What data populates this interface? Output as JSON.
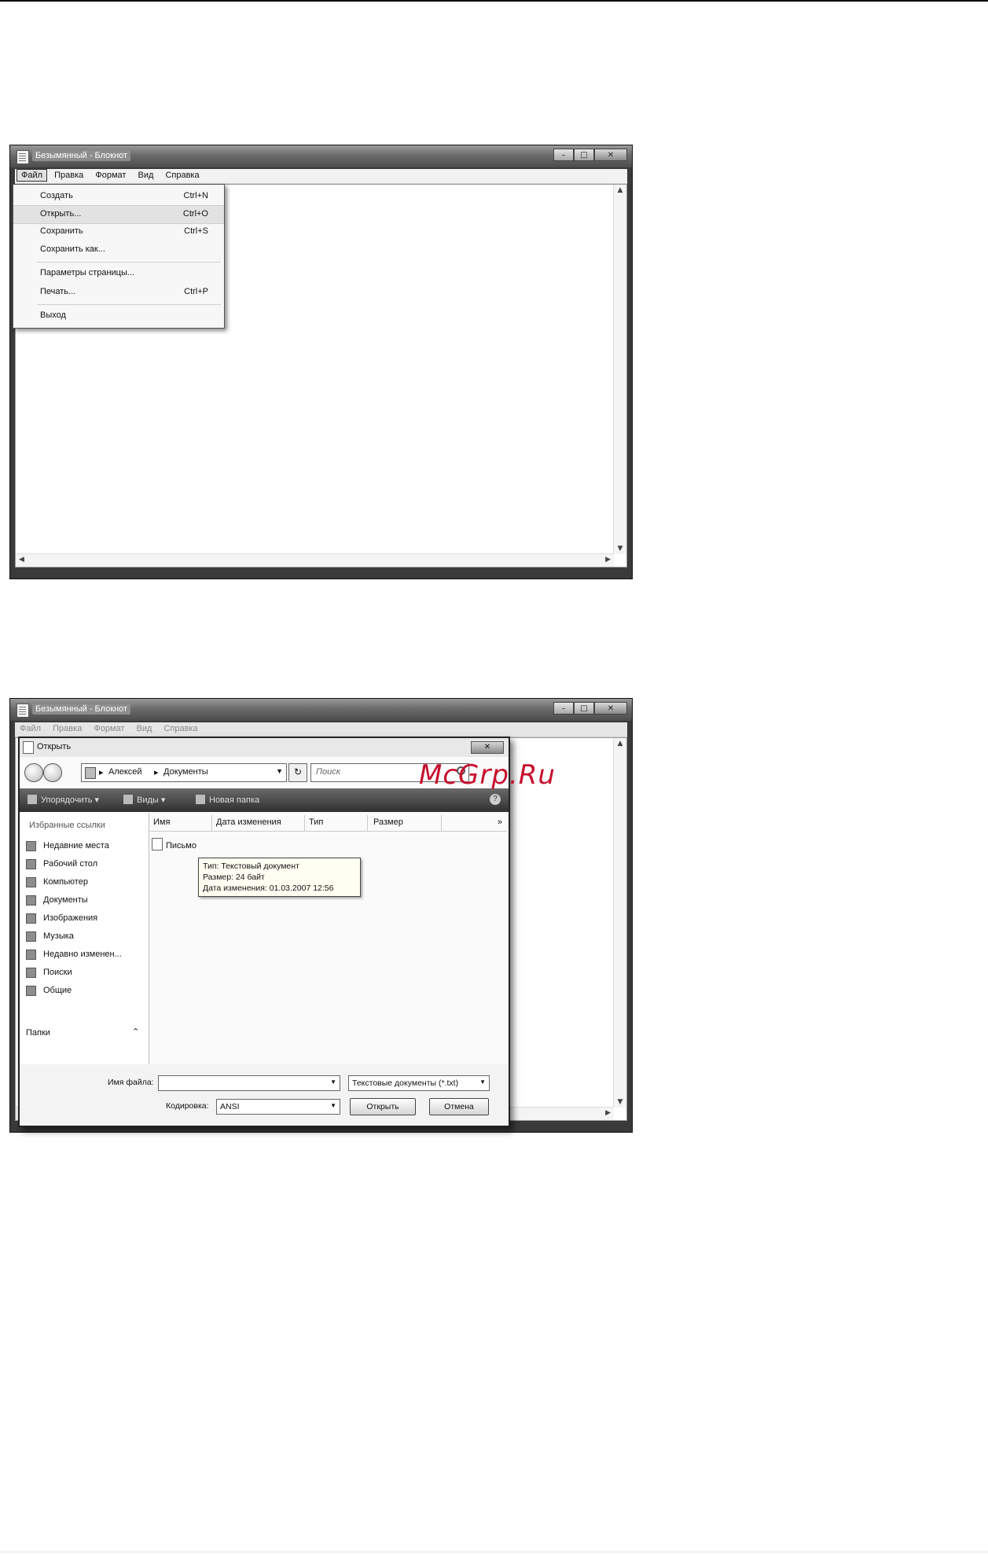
{
  "notepad": {
    "title": "Безымянный - Блокнот",
    "menu": [
      "Файл",
      "Правка",
      "Формат",
      "Вид",
      "Справка"
    ],
    "file_menu": [
      {
        "label": "Создать",
        "shortcut": "Ctrl+N"
      },
      {
        "label": "Открыть...",
        "shortcut": "Ctrl+O"
      },
      {
        "label": "Сохранить",
        "shortcut": "Ctrl+S"
      },
      {
        "label": "Сохранить как...",
        "shortcut": ""
      },
      {
        "label": "Параметры страницы...",
        "shortcut": ""
      },
      {
        "label": "Печать...",
        "shortcut": "Ctrl+P"
      },
      {
        "label": "Выход",
        "shortcut": ""
      }
    ],
    "highlighted_item": "Открыть..."
  },
  "open_dialog": {
    "title": "Открыть",
    "breadcrumb": [
      "Алексей",
      "Документы"
    ],
    "search_placeholder": "Поиск",
    "toolbar": {
      "organize": "Упорядочить",
      "views": "Виды",
      "new_folder": "Новая папка"
    },
    "favorites_header": "Избранные ссылки",
    "favorites": [
      "Недавние места",
      "Рабочий стол",
      "Компьютер",
      "Документы",
      "Изображения",
      "Музыка",
      "Недавно изменен...",
      "Поиски",
      "Общие"
    ],
    "folders_label": "Папки",
    "columns": [
      "Имя",
      "Дата изменения",
      "Тип",
      "Размер"
    ],
    "more_columns": "»",
    "file_name": "Письмо",
    "tooltip": {
      "type": "Тип: Текстовый документ",
      "size": "Размер: 24 байт",
      "modified": "Дата изменения: 01.03.2007 12:56"
    },
    "filename_label": "Имя файла:",
    "filename_value": "",
    "filter_value": "Текстовые документы (*.txt)",
    "encoding_label": "Кодировка:",
    "encoding_value": "ANSI",
    "open_button": "Открыть",
    "cancel_button": "Отмена"
  },
  "watermark": "McGrp.Ru"
}
